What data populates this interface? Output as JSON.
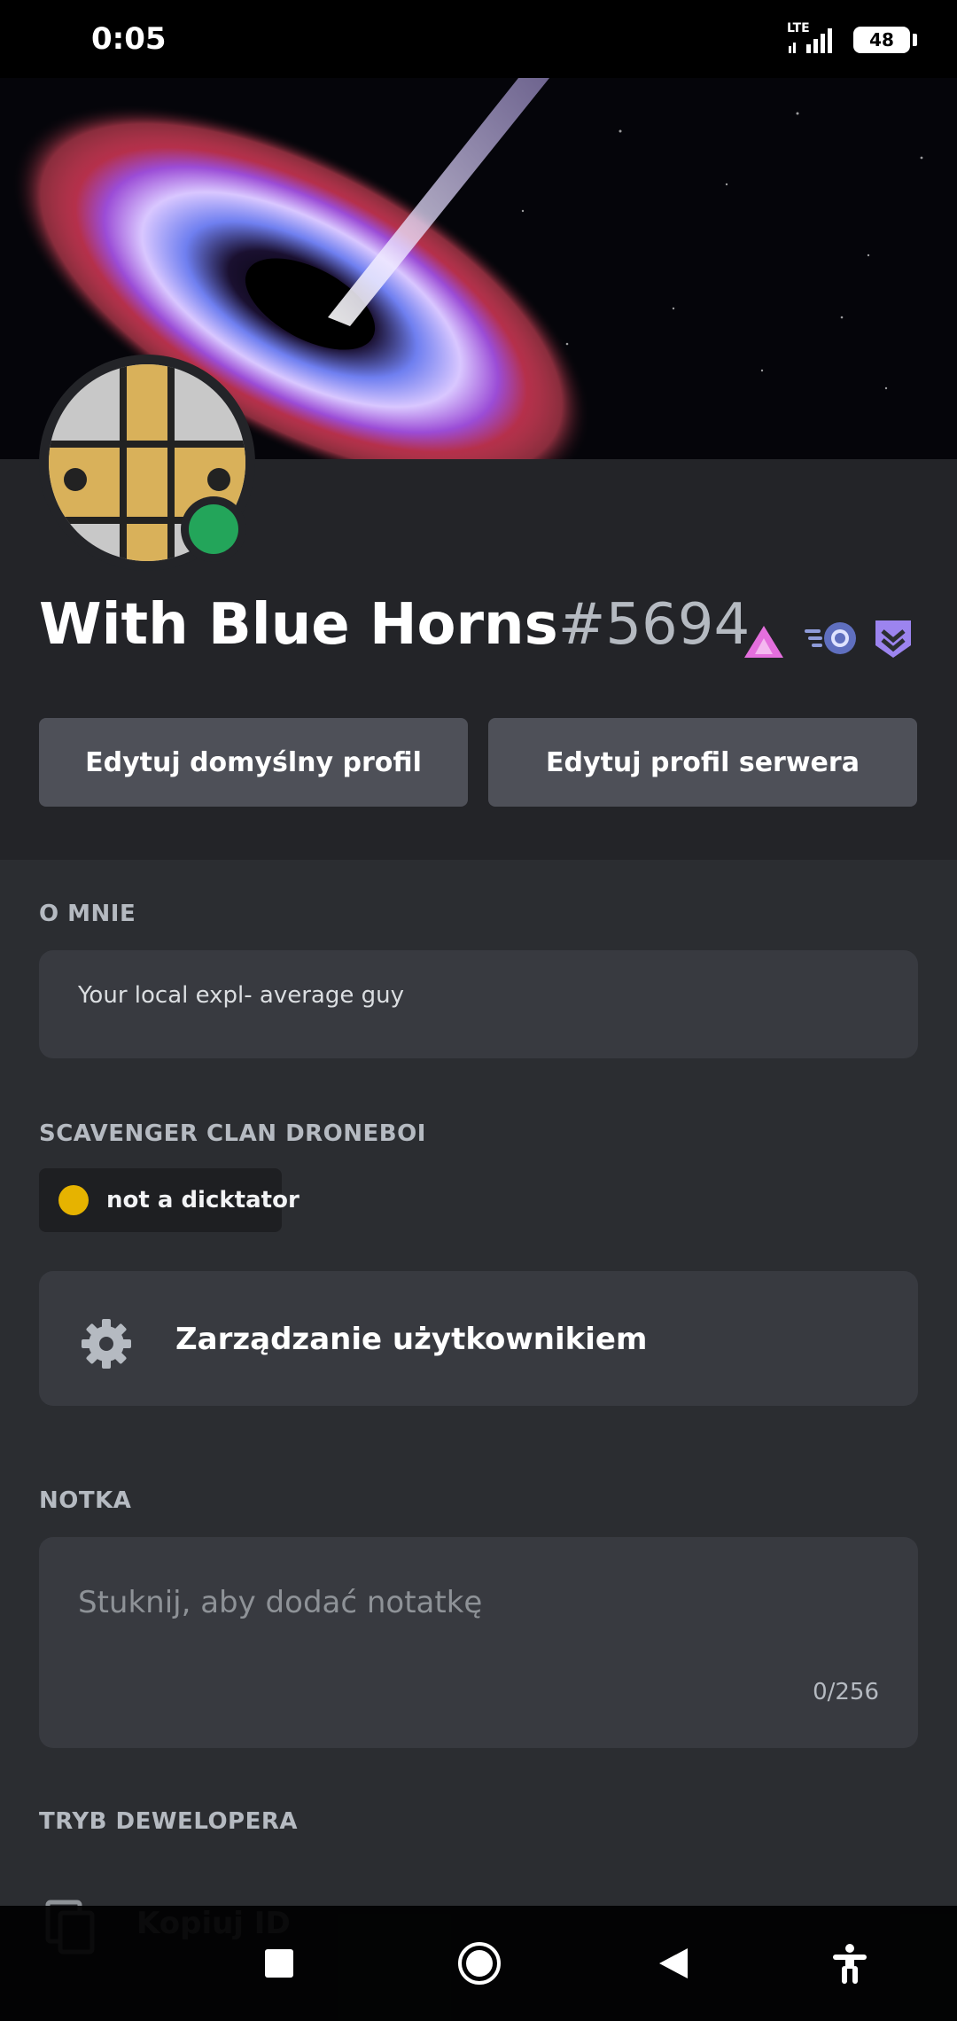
{
  "status_bar": {
    "time": "0:05",
    "network": "LTE",
    "battery": "48"
  },
  "profile": {
    "username": "With Blue Horns",
    "discriminator": "#5694",
    "status_color": "#23a55a",
    "badges": [
      "hypesquad-balance-icon",
      "nitro-boost-icon",
      "hypesquad-bravery-icon"
    ]
  },
  "buttons": {
    "edit_default": "Edytuj domyślny profil",
    "edit_server": "Edytuj profil serwera"
  },
  "about": {
    "label": "O MNIE",
    "text": "Your local expl- average guy"
  },
  "roles": {
    "label": "SCAVENGER CLAN DRONEBOI",
    "items": [
      {
        "name": "not a dicktator",
        "color": "#e6b300"
      }
    ]
  },
  "manage": {
    "label": "Zarządzanie użytkownikiem"
  },
  "note": {
    "label": "NOTKA",
    "placeholder": "Stuknij, aby dodać notatkę",
    "count": "0/256"
  },
  "developer": {
    "label": "TRYB DEWELOPERA",
    "copy_id": "Kopiuj ID"
  },
  "colors": {
    "background": "#2b2d31",
    "header": "#232428",
    "card": "#383a40",
    "button": "#4e5058"
  }
}
